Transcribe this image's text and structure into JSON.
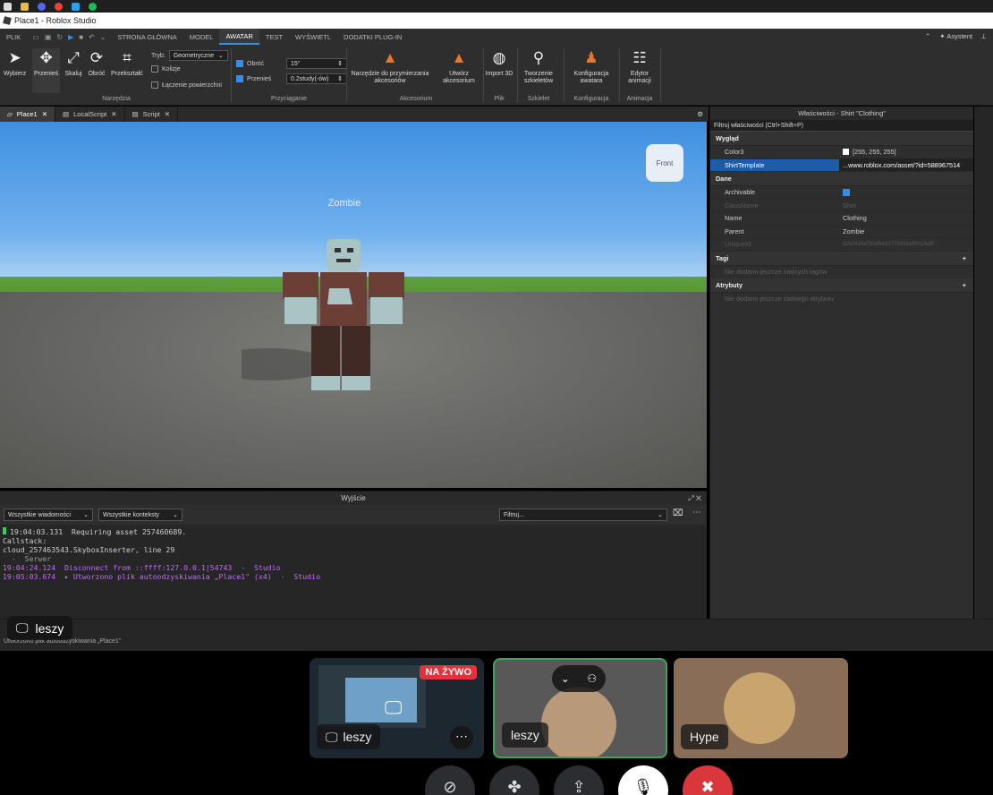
{
  "window": {
    "title": "Place1 - Roblox Studio"
  },
  "menu": {
    "items": [
      "PLIK",
      "STRONA GŁÓWNA",
      "MODEL",
      "AWATAR",
      "TEST",
      "WYŚWIETL",
      "DODATKI PLUG-IN"
    ],
    "active": "AWATAR",
    "assistant": "Asystent"
  },
  "ribbon": {
    "tools": [
      "Wybierz",
      "Przenieś",
      "Skaluj",
      "Obróć",
      "Przekształć"
    ],
    "mode_label": "Tryb:",
    "mode_value": "Geometryczne",
    "collisions": "Kolizje",
    "surface_join": "Łączenie powierzchni",
    "tools_group": "Narzędzia",
    "rotate_label": "Obróć",
    "rotate_value": "15°",
    "move_label": "Przenieś",
    "move_value": "0.2study(-ów)",
    "snap_group": "Przyciąganie",
    "accessory_fit": "Narzędzie do przymierzania akcesoriów",
    "create_accessory": "Utwórz akcesorium",
    "accessory_group": "Akcesorium",
    "import3d": "Import 3D",
    "file_group": "Plik",
    "rig_builder": "Tworzenie szkieletów",
    "skeleton_group": "Szkielet",
    "avatar_config": "Konfiguracja awatara",
    "config_group": "Konfiguracja",
    "anim_editor": "Edytor animacji",
    "anim_group": "Animacja"
  },
  "doc_tabs": [
    "Place1",
    "LocalScript",
    "Script"
  ],
  "viewport": {
    "npc_name": "Zombie",
    "viewcube_label": "Front"
  },
  "output": {
    "title": "Wyjście",
    "filter_messages": "Wszystkie wiadomości",
    "filter_contexts": "Wszystkie konteksty",
    "filter_placeholder": "Filtruj...",
    "lines": [
      "19:04:03.131  Requiring asset 257460689.",
      "Callstack:",
      "cloud_257463543.SkyboxInserter, line 29",
      "  -  Serwer",
      "19:04:24.124  Disconnect from ::ffff:127.0.0.1|54743  -  Studio",
      "19:05:03.674  ▸ Utworzono plik autoodzyskiwania „Place1\" (x4)  -  Studio"
    ]
  },
  "properties": {
    "title": "Właściwości - Shirt \"Clothing\"",
    "filter": "Filtruj właściwości (Ctrl+Shift+P)",
    "sections": {
      "appearance": "Wygląd",
      "data": "Dane",
      "tags": "Tagi",
      "attributes": "Atrybuty"
    },
    "color3_name": "Color3",
    "color3_value": "[255, 255, 255]",
    "shirt_name": "ShirtTemplate",
    "shirt_value": "...www.roblox.com/asset/?id=588967514",
    "archivable_name": "Archivable",
    "classname_name": "ClassName",
    "classname_value": "Shirt",
    "name_name": "Name",
    "name_value": "Clothing",
    "parent_name": "Parent",
    "parent_value": "Zombie",
    "uniqueid_name": "UniqueId",
    "uniqueid_value": "62b2435af30af6d10773d43a00013e2f",
    "tags_empty": "Nie dodano jeszcze żadnych tagów",
    "attrs_empty": "Nie dodano jeszcze żadnego atrybutu"
  },
  "status": {
    "text": "Utworzono plik autoodzyskiwania „Place1\""
  },
  "call": {
    "stream_owner": "leszy",
    "live_badge": "NA ŻYWO",
    "participants": [
      "leszy",
      "leszy",
      "Hype"
    ]
  },
  "colors": {
    "accent": "#3a8ce6",
    "live": "#e4323c",
    "selected_row": "#1a5da8",
    "log_purple": "#c36bf2"
  }
}
